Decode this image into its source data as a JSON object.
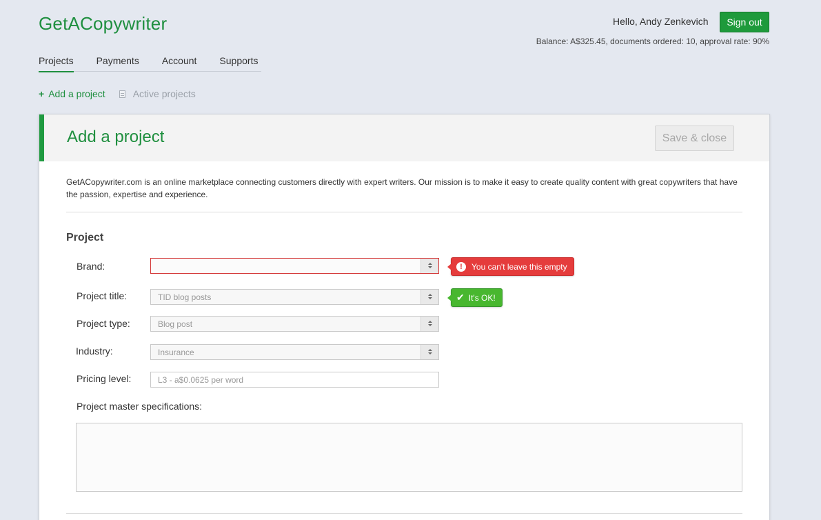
{
  "header": {
    "logo": "GetACopywriter",
    "greeting": "Hello, Andy Zenkevich",
    "signout_label": "Sign out",
    "balance_text": "Balance: A$325.45, documents ordered: 10, approval rate: 90%"
  },
  "nav": {
    "items": [
      {
        "label": "Projects",
        "active": true
      },
      {
        "label": "Payments",
        "active": false
      },
      {
        "label": "Account",
        "active": false
      },
      {
        "label": "Supports",
        "active": false
      }
    ]
  },
  "subnav": {
    "add_label": "Add a project",
    "active_label": "Active projects"
  },
  "panel": {
    "title": "Add a project",
    "save_label": "Save & close",
    "intro": "GetACopywriter.com is an online marketplace connecting customers directly with expert writers. Our mission is to make it easy to create quality content with great copywriters that have the passion, expertise and experience.",
    "section_title": "Project"
  },
  "form": {
    "brand": {
      "label": "Brand:",
      "value": "",
      "error": "You can't leave this empty"
    },
    "project_title": {
      "label": "Project title:",
      "value": "TID blog posts",
      "ok": "It's OK!"
    },
    "project_type": {
      "label": "Project type:",
      "value": "Blog post"
    },
    "industry": {
      "label": "Industry:",
      "value": "Insurance"
    },
    "pricing_level": {
      "label": "Pricing level:",
      "value": "L3 - a$0.0625 per word"
    },
    "specs": {
      "label": "Project master specifications:",
      "value": ""
    }
  },
  "colors": {
    "brand_green": "#1f8f3f",
    "error_red": "#e53c3c",
    "ok_green": "#48b72f",
    "background": "#e4e8f0"
  }
}
